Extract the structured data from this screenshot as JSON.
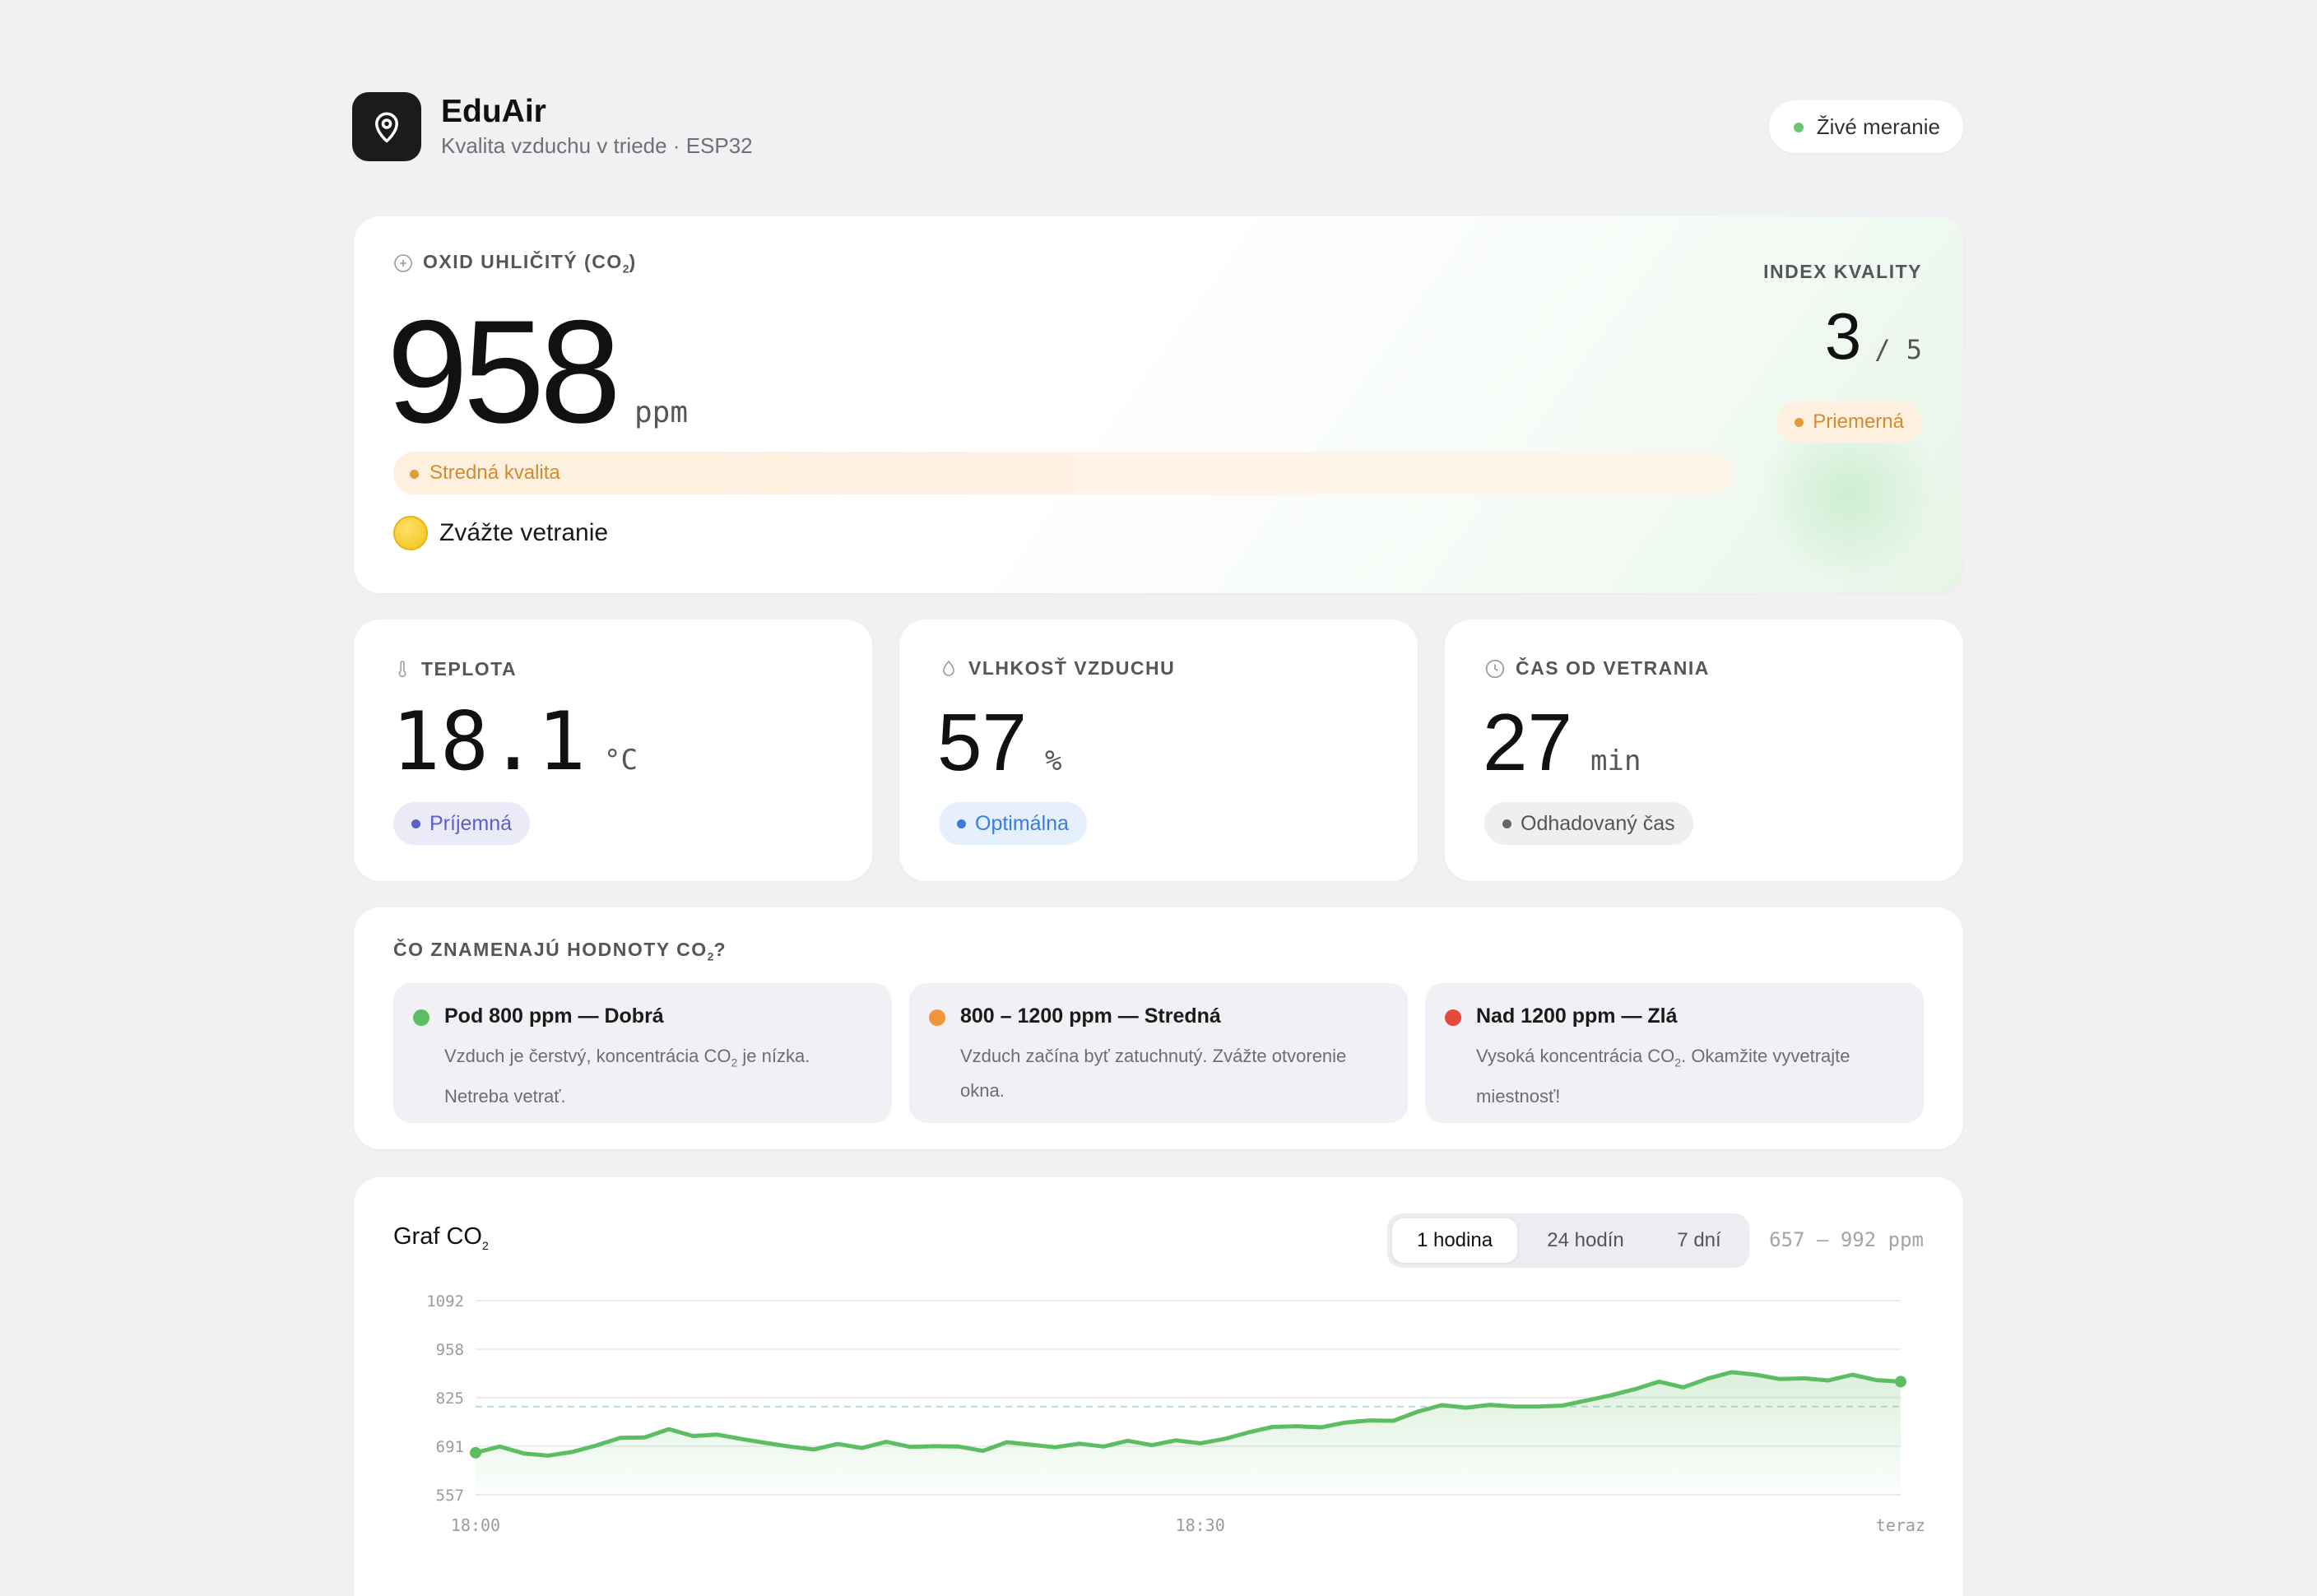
{
  "header": {
    "title": "EduAir",
    "subtitle": "Kvalita vzduchu v triede · ESP32",
    "status": "Živé meranie",
    "colors": {
      "live": "#6cc46f",
      "logo_bg": "#1b1b1d"
    }
  },
  "co2": {
    "label": "OXID UHLIČITÝ (CO",
    "label_sub": "2",
    "label_end": ")",
    "value": "958",
    "unit": "ppm",
    "quality": "Stredná kvalita",
    "advice": "Zvážte vetranie",
    "index_label": "INDEX KVALITY",
    "index_value": "3",
    "index_max": "/ 5",
    "index_status": "Priemerná",
    "colors": {
      "medium": "#e39a3c"
    }
  },
  "metrics": {
    "temperature": {
      "label": "TEPLOTA",
      "value": "18.1",
      "unit": "°C",
      "status": "Príjemná",
      "color": "#5b5fc7"
    },
    "humidity": {
      "label": "VLHKOSŤ VZDUCHU",
      "value": "57",
      "unit": "%",
      "status": "Optimálna",
      "color": "#3a7be0"
    },
    "ventilation": {
      "label": "ČAS OD VETRANIA",
      "value": "27",
      "unit": "min",
      "status": "Odhadovaný čas",
      "color": "#666"
    }
  },
  "legend": {
    "title": "ČO ZNAMENAJÚ HODNOTY CO",
    "title_sub": "2",
    "title_end": "?",
    "items": [
      {
        "title": "Pod 800 ppm — Dobrá",
        "text_a": "Vzduch je čerstvý, koncentrácia CO",
        "text_sub": "2",
        "text_b": " je nízka. Netreba vetrať.",
        "color": "#5cbd62"
      },
      {
        "title": "800 – 1200 ppm — Stredná",
        "text_a": "Vzduch začína byť zatuchnutý. Zvážte otvorenie okna.",
        "text_sub": "",
        "text_b": "",
        "color": "#f0953a"
      },
      {
        "title": "Nad 1200 ppm — Zlá",
        "text_a": "Vysoká koncentrácia CO",
        "text_sub": "2",
        "text_b": ". Okamžite vyvetrajte miestnosť!",
        "color": "#e5473c"
      }
    ]
  },
  "chart": {
    "title": "Graf CO",
    "title_sub": "2",
    "tabs": [
      "1 hodina",
      "24 hodín",
      "7 dní"
    ],
    "active_tab": "1 hodina",
    "range": "657 – 992 ppm"
  },
  "chart_data": {
    "type": "area",
    "ylabel": "",
    "xlabel": "",
    "y_ticks": [
      557,
      691,
      825,
      958,
      1092
    ],
    "x_tick_labels": [
      "18:00",
      "18:30",
      "teraz"
    ],
    "ylim": [
      557,
      1092
    ],
    "threshold": 800,
    "color": "#5cbd62",
    "x": [
      0,
      1,
      2,
      3,
      4,
      5,
      6,
      7,
      8,
      9,
      10,
      11,
      12,
      13,
      14,
      15,
      16,
      17,
      18,
      19,
      20,
      21,
      22,
      23,
      24,
      25,
      26,
      27,
      28,
      29,
      30,
      31,
      32,
      33,
      34,
      35,
      36,
      37,
      38,
      39,
      40,
      41,
      42,
      43,
      44,
      45,
      46,
      47,
      48,
      49,
      50,
      51,
      52,
      53,
      54,
      55,
      56,
      57,
      58,
      59
    ],
    "values": [
      673,
      690,
      671,
      665,
      675,
      693,
      714,
      715,
      738,
      719,
      723,
      711,
      700,
      690,
      682,
      697,
      686,
      703,
      689,
      691,
      690,
      678,
      702,
      695,
      688,
      698,
      690,
      706,
      694,
      707,
      699,
      711,
      729,
      744,
      746,
      743,
      756,
      762,
      761,
      786,
      804,
      797,
      805,
      800,
      800,
      803,
      817,
      831,
      848,
      869,
      853,
      877,
      895,
      888,
      876,
      878,
      872,
      888,
      873,
      869
    ]
  }
}
